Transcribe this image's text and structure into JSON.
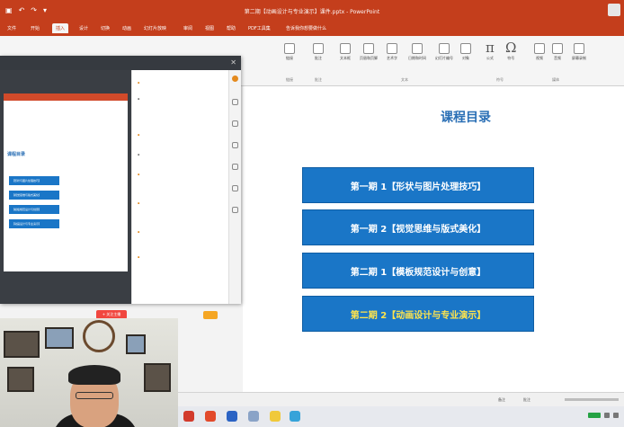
{
  "titlebar": {
    "title": "第二期【动画设计与专业演示】课件.pptx - PowerPoint",
    "quick_access": [
      "save",
      "undo",
      "redo",
      "customize"
    ]
  },
  "tabs": [
    "文件",
    "开始",
    "插入",
    "设计",
    "切换",
    "动画",
    "幻灯片放映",
    "审阅",
    "视图",
    "帮助",
    "PDF工具集",
    "告诉我你想要做什么"
  ],
  "active_tab": "插入",
  "ribbon": {
    "groups": [
      {
        "label": "链接",
        "buttons": [
          "链接"
        ]
      },
      {
        "label": "批注",
        "buttons": [
          "批注"
        ]
      },
      {
        "label": "文本",
        "buttons": [
          "文本框",
          "页眉和页脚",
          "艺术字",
          "日期和时间",
          "幻灯片编号",
          "对象"
        ]
      },
      {
        "label": "符号",
        "buttons": [
          "公式",
          "符号"
        ]
      },
      {
        "label": "媒体",
        "buttons": [
          "视频",
          "音频",
          "屏幕录制"
        ]
      }
    ],
    "equation_glyph": "π",
    "symbol_glyph": "Ω"
  },
  "slide": {
    "title": "课程目录",
    "items": [
      "第一期 1【形状与图片处理技巧】",
      "第一期 2【视觉思维与版式美化】",
      "第二期 1【模板规范设计与创意】",
      "第二期 2【动画设计与专业演示】"
    ],
    "highlighted_index": 3
  },
  "overlay": {
    "mini_title": "课程目录",
    "mini_items": [
      "【形状与图片处理技巧】",
      "【视觉思维与版式美化】",
      "【模板规范设计与创意】",
      "【动画设计与专业演示】"
    ],
    "pill_label": "+ 关注主播"
  },
  "statusbar": {
    "notes": "备注",
    "comments": "批注",
    "zoom": "—"
  },
  "colors": {
    "accent": "#c43e1c",
    "toc_button": "#1a76c7",
    "highlight_text": "#ffe44d",
    "slide_title": "#2a6fb5"
  }
}
